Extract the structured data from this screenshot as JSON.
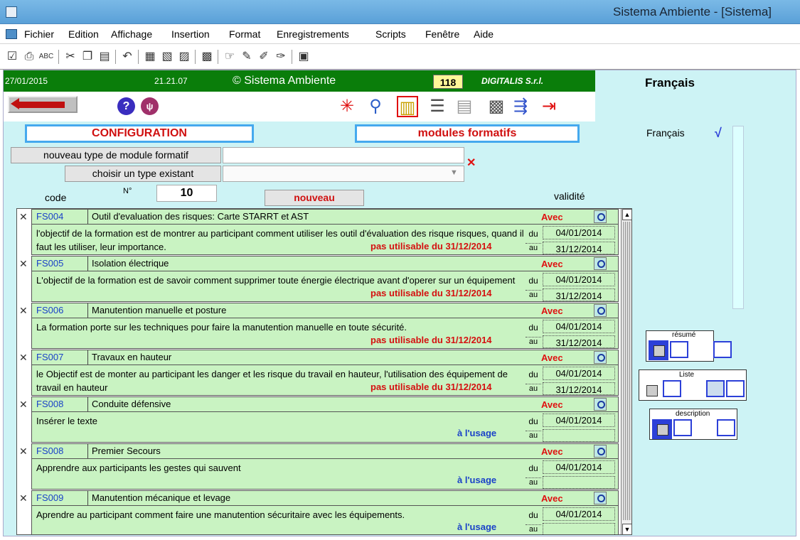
{
  "window": {
    "title": "Sistema Ambiente - [Sistema]"
  },
  "menu": [
    "Fichier",
    "Edition",
    "Affichage",
    "Insertion",
    "Format",
    "Enregistrements",
    "Scripts",
    "Fenêtre",
    "Aide"
  ],
  "toolbar_icons": [
    "checkbox-icon",
    "print-icon",
    "spellcheck-icon",
    "cut-icon",
    "copy-icon",
    "paste-icon",
    "undo-icon",
    "table-icon",
    "table-add-icon",
    "table-delete-icon",
    "sort-icon",
    "record-icon",
    "script-icon",
    "script-run-icon",
    "script-debug-icon",
    "help-icon"
  ],
  "status": {
    "date": "27/01/2015",
    "time": "21.21.07",
    "copyright": "© Sistema Ambiente",
    "counter": "118",
    "company": "DIGITALIS S.r.l.",
    "language": "Français"
  },
  "nav": {
    "help_label": "?",
    "counter_icon": "ψ"
  },
  "panel": {
    "configuration_label": "CONFIGURATION",
    "modules_label": "modules formatifs",
    "new_type_button": "nouveau type de module formatif",
    "choose_type_button": "choisir un type existant",
    "new_type_value": "",
    "choose_type_value": "",
    "code_label": "code",
    "number_label": "N°",
    "number_value": "10",
    "new_button": "nouveau",
    "validity_label": "validité"
  },
  "records": [
    {
      "code": "FS004",
      "name": "Outil d'evaluation des risques: Carte STARRT et AST",
      "status": "Avec",
      "desc": "l'objectif de la formation est de montrer au participant comment utiliser les outil d'évaluation des risque risques, quand il faut les utiliser, leur importance.",
      "note": "pas utilisable du 31/12/2014",
      "from_label": "du",
      "to_label": "au",
      "from": "04/01/2014",
      "to": "31/12/2014"
    },
    {
      "code": "FS005",
      "name": "Isolation électrique",
      "status": "Avec",
      "desc": "L'objectif de la formation est de savoir comment supprimer toute énergie électrique avant d'operer sur un équipement",
      "note": "pas utilisable du 31/12/2014",
      "from_label": "du",
      "to_label": "au",
      "from": "04/01/2014",
      "to": "31/12/2014"
    },
    {
      "code": "FS006",
      "name": "Manutention manuelle et posture",
      "status": "Avec",
      "desc": "La formation porte sur les techniques pour faire la manutention manuelle en toute sécurité.",
      "note": "pas utilisable du 31/12/2014",
      "from_label": "du",
      "to_label": "au",
      "from": "04/01/2014",
      "to": "31/12/2014"
    },
    {
      "code": "FS007",
      "name": "Travaux en hauteur",
      "status": "Avec",
      "desc": "le Objectif est de monter au participant les danger et les risque du travail en hauteur, l'utilisation des équipement de travail en hauteur",
      "note": "pas utilisable du 31/12/2014",
      "from_label": "du",
      "to_label": "au",
      "from": "04/01/2014",
      "to": "31/12/2014"
    },
    {
      "code": "FS008",
      "name": "Conduite défensive",
      "status": "Avec",
      "desc": "Insérer le texte",
      "note": "à l'usage",
      "from_label": "du",
      "to_label": "au",
      "from": "04/01/2014",
      "to": ""
    },
    {
      "code": "FS008",
      "name": "Premier Secours",
      "status": "Avec",
      "desc": "Apprendre aux participants les gestes qui sauvent",
      "note": "à l'usage",
      "from_label": "du",
      "to_label": "au",
      "from": "04/01/2014",
      "to": ""
    },
    {
      "code": "FS009",
      "name": "Manutention mécanique et levage",
      "status": "Avec",
      "desc": "Aprendre au participant comment faire une manutention sécuritaire avec les équipements.",
      "note": "à l'usage",
      "from_label": "du",
      "to_label": "au",
      "from": "04/01/2014",
      "to": ""
    }
  ],
  "side": {
    "language_item": "Français",
    "check": "√",
    "resume_label": "résumé",
    "list_label": "Liste",
    "description_label": "description"
  },
  "colors": {
    "green_bar": "#0a7d0a",
    "panel_bg": "#cdf3f5",
    "row_bg": "#c9f3c2",
    "accent_red": "#d01010",
    "accent_blue": "#45a9ee"
  }
}
